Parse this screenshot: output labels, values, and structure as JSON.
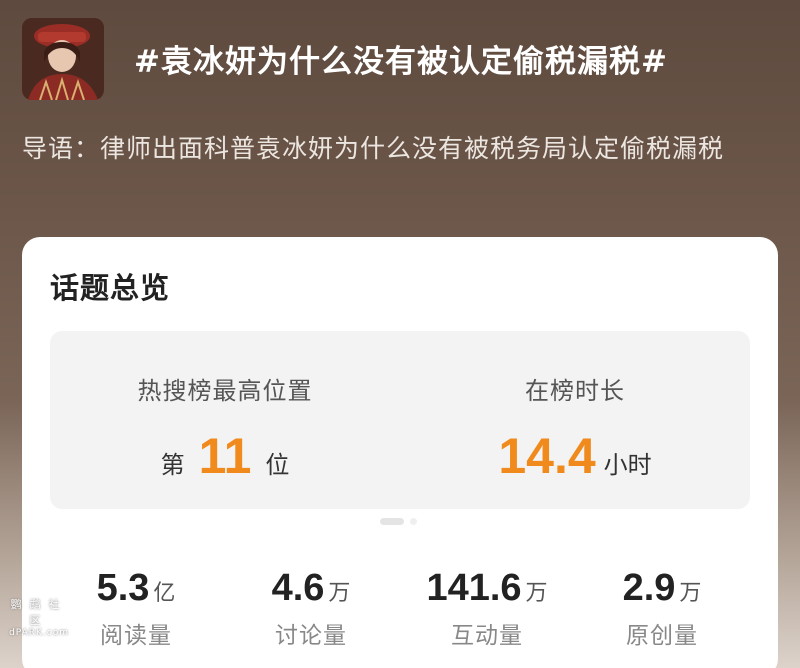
{
  "header": {
    "topic_title": "#袁冰妍为什么没有被认定偷税漏税#",
    "intro": "导语：律师出面科普袁冰妍为什么没有被税务局认定偷税漏税"
  },
  "card": {
    "title": "话题总览",
    "hot_rank": {
      "label": "热搜榜最高位置",
      "prefix": "第",
      "value": "11",
      "suffix": "位"
    },
    "duration": {
      "label": "在榜时长",
      "value": "14.4",
      "unit": "小时"
    },
    "metrics": [
      {
        "value": "5.3",
        "unit": "亿",
        "label": "阅读量"
      },
      {
        "value": "4.6",
        "unit": "万",
        "label": "讨论量"
      },
      {
        "value": "141.6",
        "unit": "万",
        "label": "互动量"
      },
      {
        "value": "2.9",
        "unit": "万",
        "label": "原创量"
      }
    ]
  },
  "watermark": {
    "line1": "鹦鹉社区",
    "line2": "dPARK.com"
  },
  "colors": {
    "accent": "#f08a1c"
  },
  "icons": {
    "avatar": "avatar-photo"
  }
}
